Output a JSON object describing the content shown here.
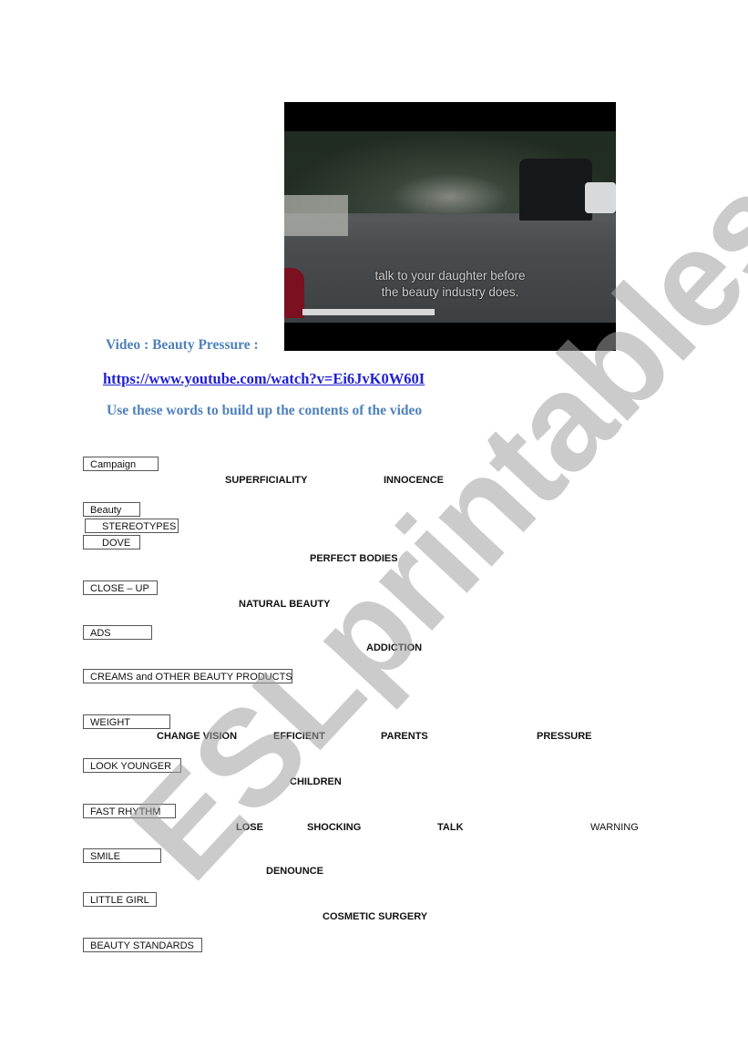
{
  "video": {
    "subtitle_line1": "talk to your daughter before",
    "subtitle_line2": "the beauty industry does."
  },
  "header": {
    "video_title": "Video :  Beauty Pressure :",
    "link": "https://www.youtube.com/watch?v=Ei6JvK0W60I",
    "instruction": "Use these words to build up the contents of the video"
  },
  "boxed_words": [
    "Campaign",
    "Beauty",
    "STEREOTYPES",
    "DOVE",
    "CLOSE – UP",
    "ADS",
    "CREAMS and OTHER BEAUTY PRODUCTS",
    "WEIGHT",
    "LOOK YOUNGER",
    "FAST RHYTHM",
    "SMILE",
    "LITTLE GIRL",
    "BEAUTY STANDARDS"
  ],
  "floating_words": [
    "SUPERFICIALITY",
    "INNOCENCE",
    "PERFECT BODIES",
    "NATURAL BEAUTY",
    "ADDICTION",
    "CHANGE VISION",
    "EFFICIENT",
    "PARENTS",
    "PRESSURE",
    "CHILDREN",
    "LOSE",
    "SHOCKING",
    "TALK",
    "WARNING",
    "DENOUNCE",
    "COSMETIC SURGERY"
  ],
  "watermark": "ESLprintables.com"
}
